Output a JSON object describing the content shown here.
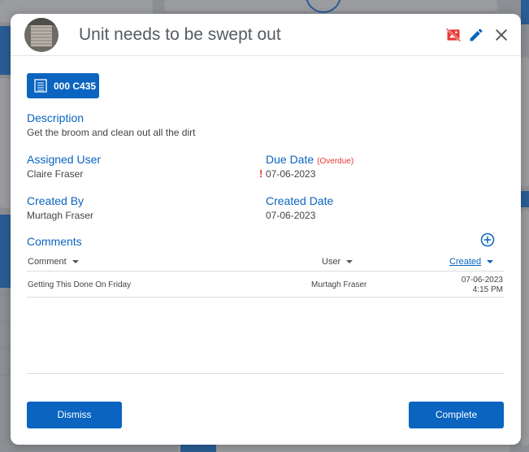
{
  "modal": {
    "title": "Unit needs to be swept out",
    "unit_tag": "000 C435",
    "description_label": "Description",
    "description": "Get the broom and clean out all the dirt",
    "assigned_user_label": "Assigned User",
    "assigned_user": "Claire Fraser",
    "due_date_label": "Due Date",
    "due_status": "(Overdue)",
    "due_alert": "!",
    "due_date": "07-06-2023",
    "created_by_label": "Created By",
    "created_by": "Murtagh Fraser",
    "created_date_label": "Created Date",
    "created_date": "07-06-2023",
    "comments_label": "Comments",
    "columns": {
      "comment": "Comment",
      "user": "User",
      "created": "Created"
    },
    "sorted_column": "created",
    "comments": [
      {
        "comment": "Getting This Done On Friday",
        "user": "Murtagh Fraser",
        "created_date": "07-06-2023",
        "created_time": "4:15 PM"
      }
    ],
    "dismiss_label": "Dismiss",
    "complete_label": "Complete"
  },
  "colors": {
    "accent": "#0a64c0",
    "overdue": "#e53935",
    "backdrop": "#8c8f93"
  },
  "icons": [
    "unit-avatar",
    "no-camera-icon",
    "pencil-icon",
    "close-icon",
    "door-icon",
    "add-circle-icon",
    "caret-down-icon"
  ]
}
